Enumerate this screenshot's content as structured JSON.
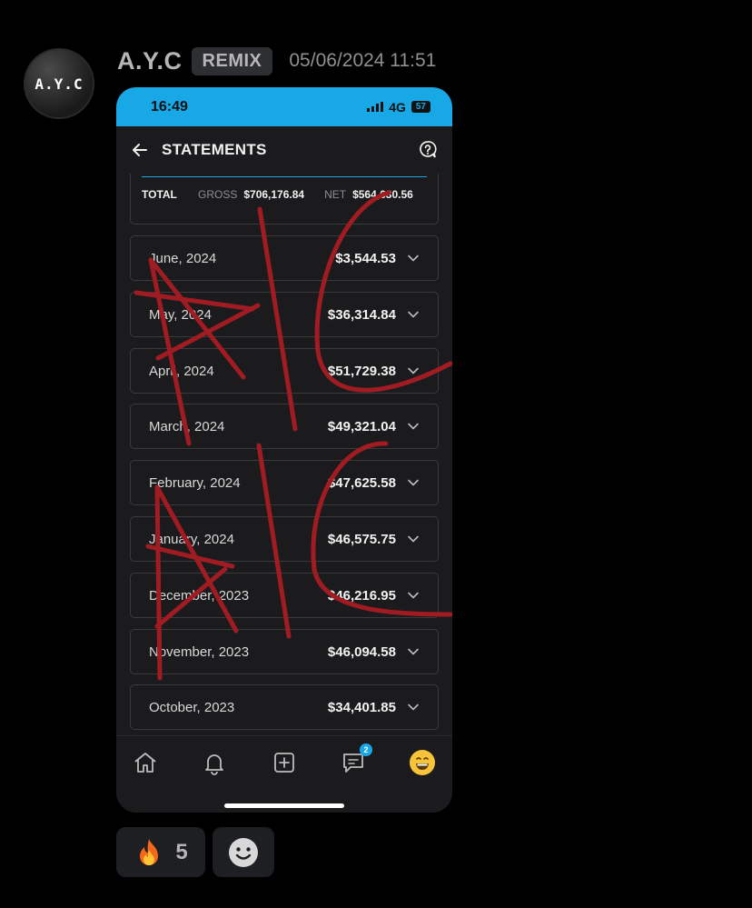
{
  "message": {
    "avatar_text": "A.Y.C",
    "username": "A.Y.C",
    "role_badge": "REMIX",
    "timestamp": "05/06/2024 11:51"
  },
  "phone": {
    "status_bar": {
      "time": "16:49",
      "network": "4G",
      "battery": "57",
      "color": "#19a8e6"
    },
    "app_bar": {
      "title": "STATEMENTS"
    },
    "totals": {
      "total_label": "TOTAL",
      "gross_label": "GROSS",
      "gross_value": "$706,176.84",
      "net_label": "NET",
      "net_value": "$564,630.56"
    },
    "statements": [
      {
        "date": "June, 2024",
        "amount": "$3,544.53"
      },
      {
        "date": "May, 2024",
        "amount": "$36,314.84"
      },
      {
        "date": "April, 2024",
        "amount": "$51,729.38"
      },
      {
        "date": "March, 2024",
        "amount": "$49,321.04"
      },
      {
        "date": "February, 2024",
        "amount": "$47,625.58"
      },
      {
        "date": "January, 2024",
        "amount": "$46,575.75"
      },
      {
        "date": "December, 2023",
        "amount": "$46,216.95"
      },
      {
        "date": "November, 2023",
        "amount": "$46,094.58"
      },
      {
        "date": "October, 2023",
        "amount": "$34,401.85"
      }
    ],
    "bottom_nav": {
      "items": [
        "home-icon",
        "bell-icon",
        "add-square-icon",
        "messages-icon",
        "emoji-icon"
      ],
      "messages_badge": "2"
    },
    "overlay_annotation": "AYC AYC"
  },
  "reactions": [
    {
      "emoji": "🔥",
      "count": "5"
    },
    {
      "emoji": "add-reaction-icon",
      "count": ""
    }
  ]
}
